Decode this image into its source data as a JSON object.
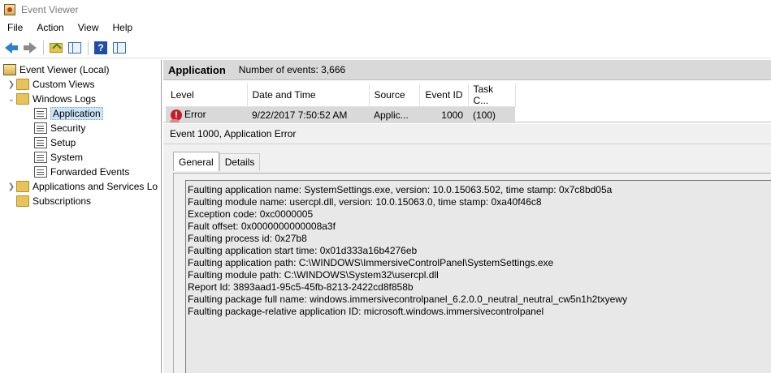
{
  "window": {
    "title": "Event Viewer"
  },
  "menu": [
    "File",
    "Action",
    "View",
    "Help"
  ],
  "toolbar": {
    "icons": [
      "back-icon",
      "forward-icon",
      "up-folder-icon",
      "show-hide-tree-icon",
      "help-icon",
      "show-hide-action-pane-icon"
    ]
  },
  "tree": {
    "root": "Event Viewer (Local)",
    "custom_views": "Custom Views",
    "windows_logs": "Windows Logs",
    "logs": [
      "Application",
      "Security",
      "Setup",
      "System",
      "Forwarded Events"
    ],
    "apps_services": "Applications and Services Lo",
    "subscriptions": "Subscriptions"
  },
  "header": {
    "log_name": "Application",
    "count_text": "Number of events: 3,666"
  },
  "events": {
    "columns": [
      "Level",
      "Date and Time",
      "Source",
      "Event ID",
      "Task C..."
    ],
    "rows": [
      {
        "level": "Error",
        "datetime": "9/22/2017 7:50:52 AM",
        "source": "Applic...",
        "event_id": "1000",
        "task": "(100)"
      }
    ]
  },
  "detail": {
    "title": "Event 1000, Application Error",
    "tabs": [
      "General",
      "Details"
    ],
    "description": [
      "Faulting application name: SystemSettings.exe, version: 10.0.15063.502, time stamp: 0x7c8bd05a",
      "Faulting module name: usercpl.dll, version: 10.0.15063.0, time stamp: 0xa40f46c8",
      "Exception code: 0xc0000005",
      "Fault offset: 0x0000000000008a3f",
      "Faulting process id: 0x27b8",
      "Faulting application start time: 0x01d333a16b4276eb",
      "Faulting application path: C:\\WINDOWS\\ImmersiveControlPanel\\SystemSettings.exe",
      "Faulting module path: C:\\WINDOWS\\System32\\usercpl.dll",
      "Report Id: 3893aad1-95c5-45fb-8213-2422cd8f858b",
      "Faulting package full name: windows.immersivecontrolpanel_6.2.0.0_neutral_neutral_cw5n1h2txyewy",
      "Faulting package-relative application ID: microsoft.windows.immersivecontrolpanel"
    ]
  },
  "colors": {
    "selection": "#cce4f7",
    "header_strip": "#d9d9d9",
    "error": "#c0202a"
  }
}
